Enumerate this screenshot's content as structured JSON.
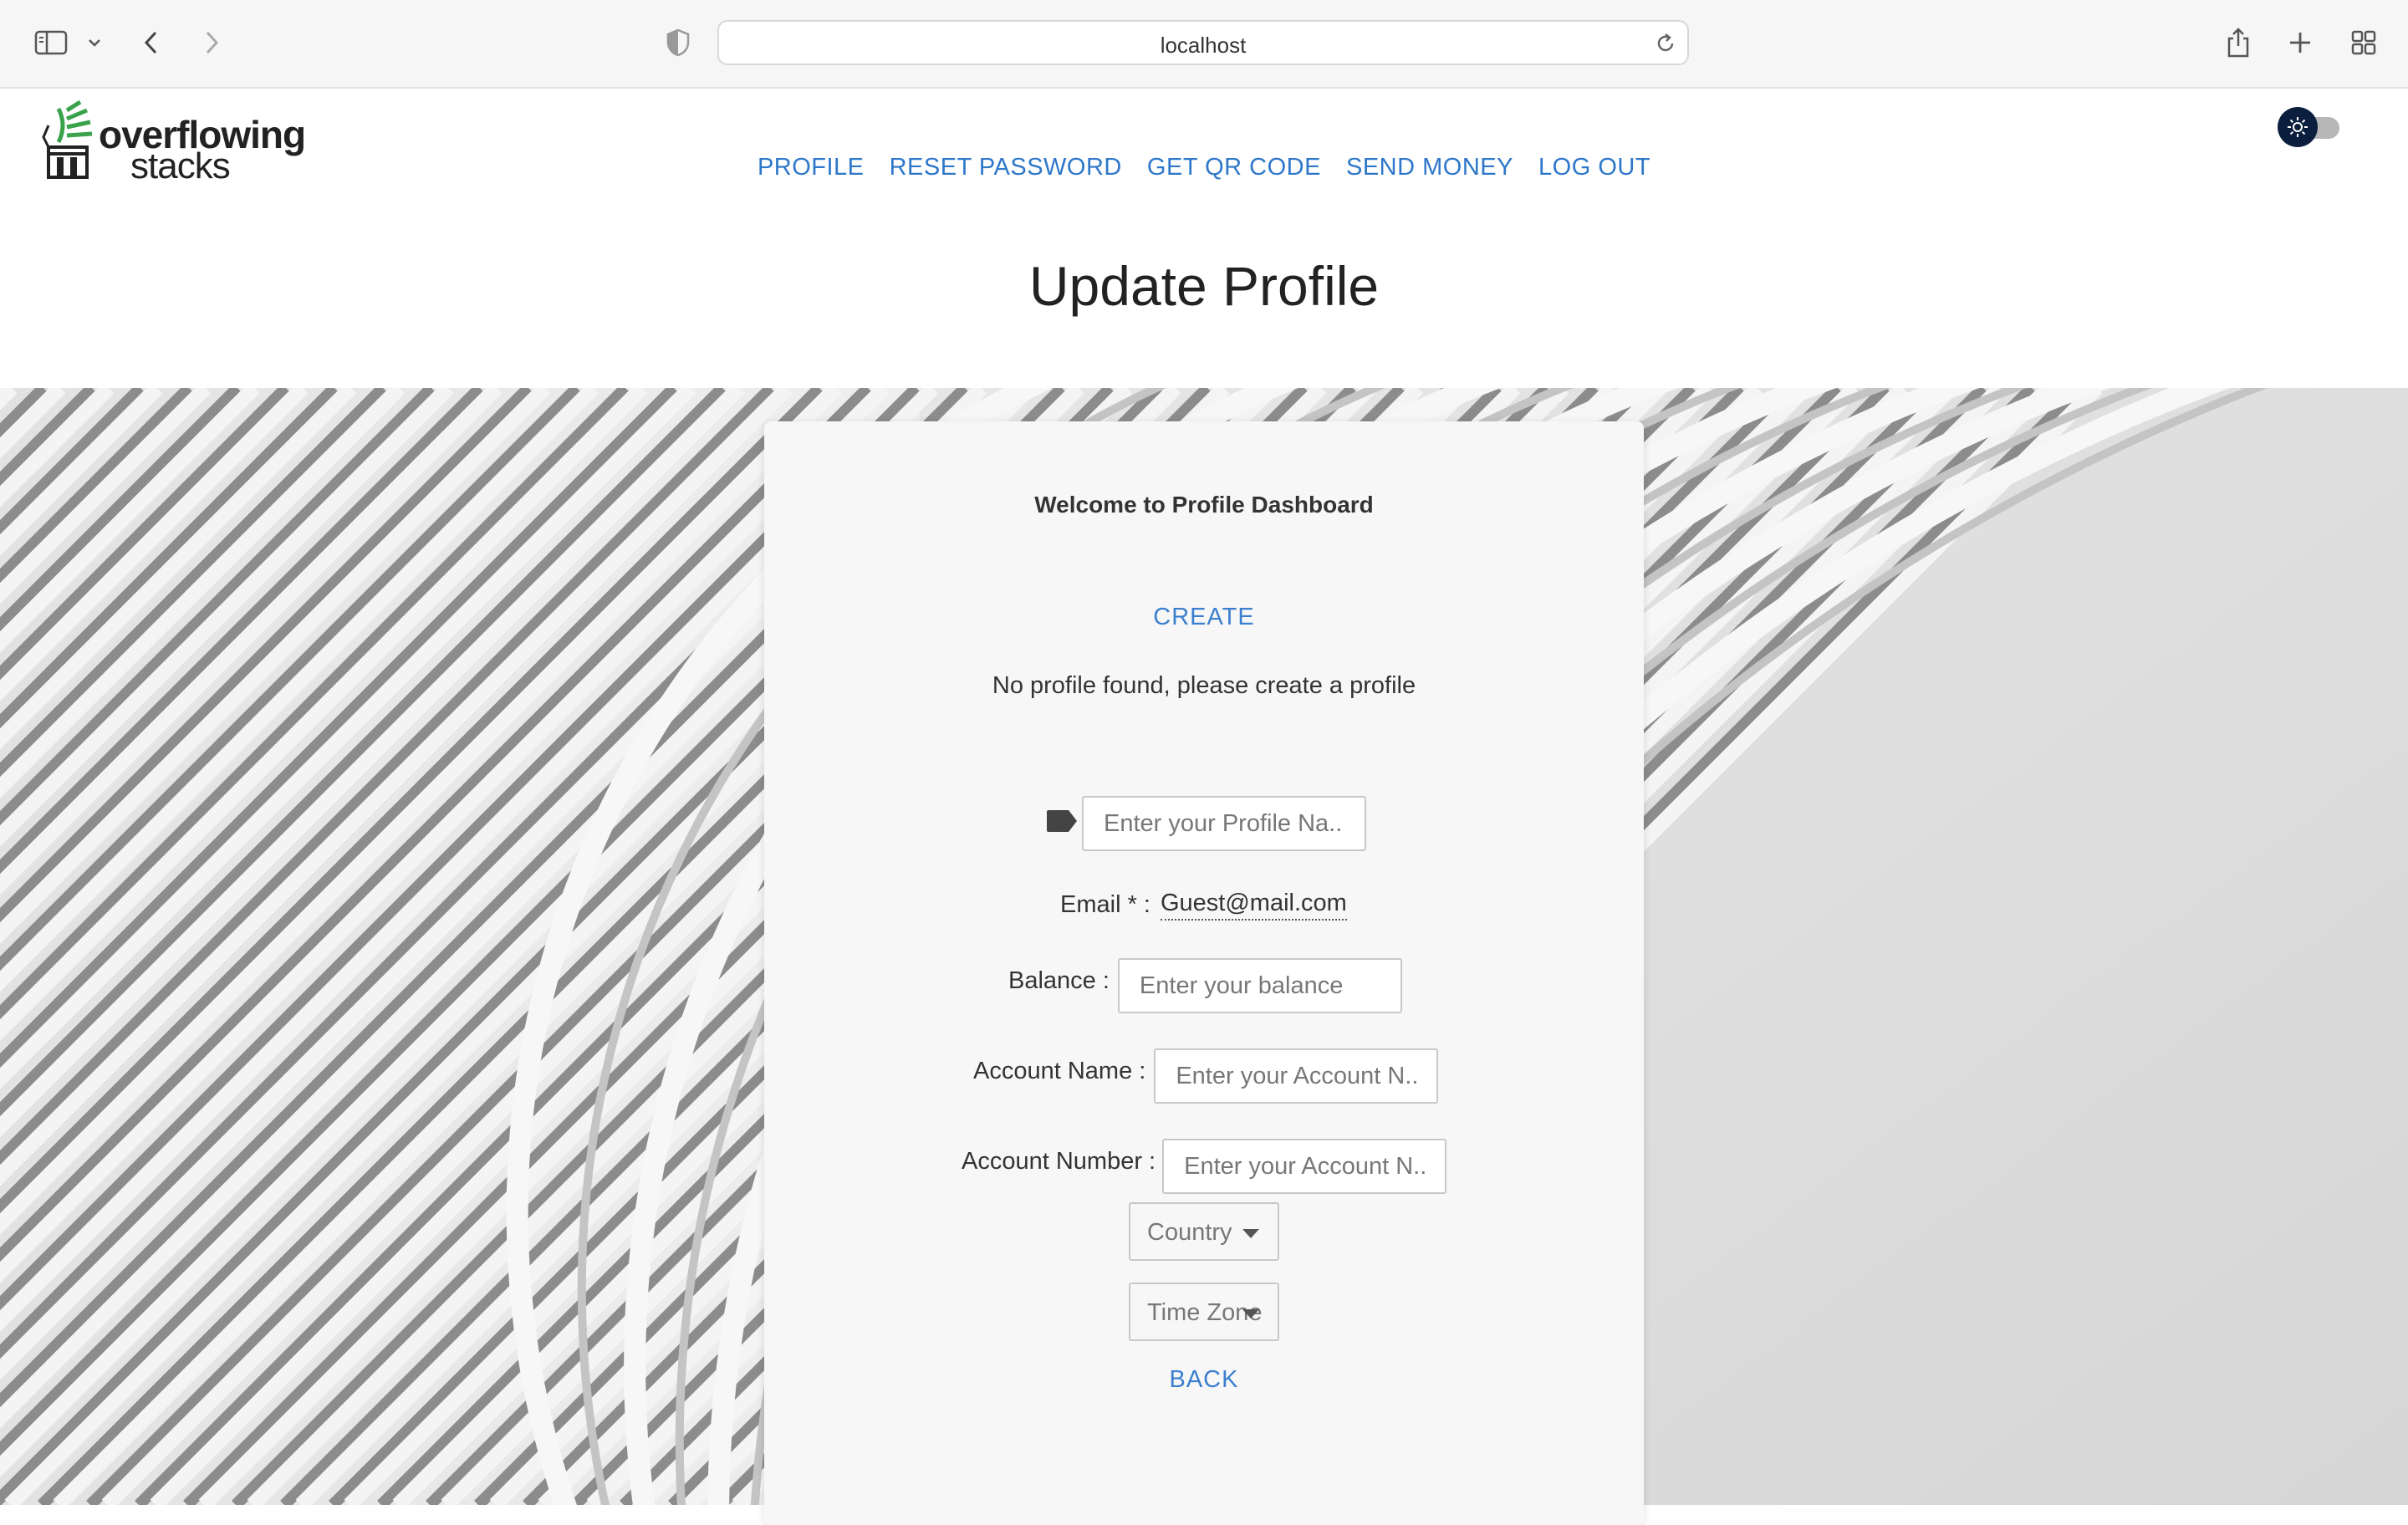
{
  "browser": {
    "url": "localhost",
    "icons": [
      "sidebar-icon",
      "chevron-down-icon",
      "back-icon",
      "forward-icon",
      "shield-icon",
      "reload-icon",
      "share-icon",
      "plus-icon",
      "tabs-grid-icon"
    ]
  },
  "site": {
    "logo": {
      "line1": "overflowing",
      "line2": "stacks"
    },
    "nav": [
      {
        "label": "PROFILE"
      },
      {
        "label": "RESET PASSWORD"
      },
      {
        "label": "GET QR CODE"
      },
      {
        "label": "SEND MONEY"
      },
      {
        "label": "LOG OUT"
      }
    ],
    "theme_toggle_icon": "sun-icon",
    "page_title": "Update Profile"
  },
  "card": {
    "welcome": "Welcome to Profile Dashboard",
    "create_label": "CREATE",
    "no_profile_message": "No profile found, please create a profile",
    "profile_name": {
      "icon": "tag-icon",
      "placeholder": "Enter your Profile Na..."
    },
    "email": {
      "label": "Email * :",
      "value": "Guest@mail.com"
    },
    "balance": {
      "label": "Balance :",
      "placeholder": "Enter your balance"
    },
    "account_name": {
      "label": "Account Name :",
      "placeholder": "Enter your Account N..."
    },
    "account_number": {
      "label": "Account Number :",
      "placeholder": "Enter your Account N..."
    },
    "country_select": {
      "value": "Country"
    },
    "timezone_select": {
      "value": "Time Zone"
    },
    "back_label": "BACK"
  },
  "colors": {
    "link": "#2e77c9",
    "logo_green": "#3aa24a",
    "toggle_knob": "#0c1e3d"
  }
}
